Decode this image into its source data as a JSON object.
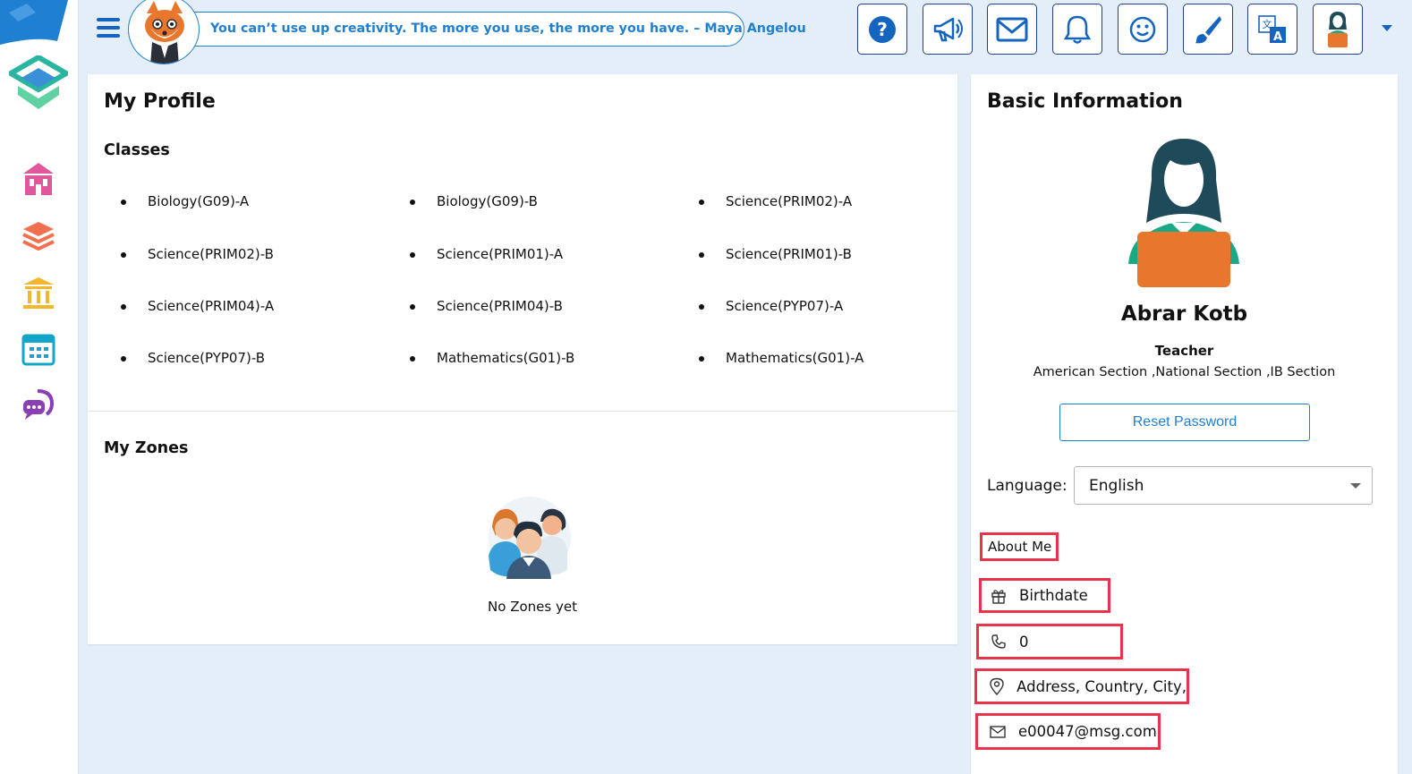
{
  "header": {
    "quote": "You can’t use up creativity. The more you use, the more you have. – Maya Angelou",
    "toolbar_icons": [
      "help-icon",
      "announcement-icon",
      "mail-icon",
      "bell-icon",
      "smiley-icon",
      "brush-icon",
      "translate-icon",
      "user-avatar-icon"
    ]
  },
  "sidebar": {
    "items": [
      {
        "icon": "school-icon",
        "color": "#e0579b"
      },
      {
        "icon": "books-icon",
        "color": "#f07050"
      },
      {
        "icon": "institution-icon",
        "color": "#f2b72c"
      },
      {
        "icon": "calendar-icon",
        "color": "#12a6c9"
      },
      {
        "icon": "chat-icon",
        "color": "#8a3fb5"
      }
    ]
  },
  "profile": {
    "title": "My Profile",
    "classes_title": "Classes",
    "classes": [
      "Biology(G09)-A",
      "Biology(G09)-B",
      "Science(PRIM02)-A",
      "Science(PRIM02)-B",
      "Science(PRIM01)-A",
      "Science(PRIM01)-B",
      "Science(PRIM04)-A",
      "Science(PRIM04)-B",
      "Science(PYP07)-A",
      "Science(PYP07)-B",
      "Mathematics(G01)-B",
      "Mathematics(G01)-A"
    ],
    "zones_title": "My Zones",
    "zones_empty": "No Zones yet"
  },
  "info": {
    "title": "Basic Information",
    "name": "Abrar Kotb",
    "role": "Teacher",
    "sections": "American Section ,National Section ,IB Section",
    "reset_label": "Reset Password",
    "language_label": "Language:",
    "language_value": "English",
    "about_label": "About Me",
    "birthdate": "Birthdate",
    "phone": "0",
    "address": "Address, Country, City,",
    "email": "e00047@msg.com"
  },
  "colors": {
    "accent": "#1f7fd1",
    "highlight": "#e8334a",
    "avatar_orange": "#e8762d",
    "avatar_teal": "#1aa886",
    "avatar_dark": "#1f4a5a"
  }
}
